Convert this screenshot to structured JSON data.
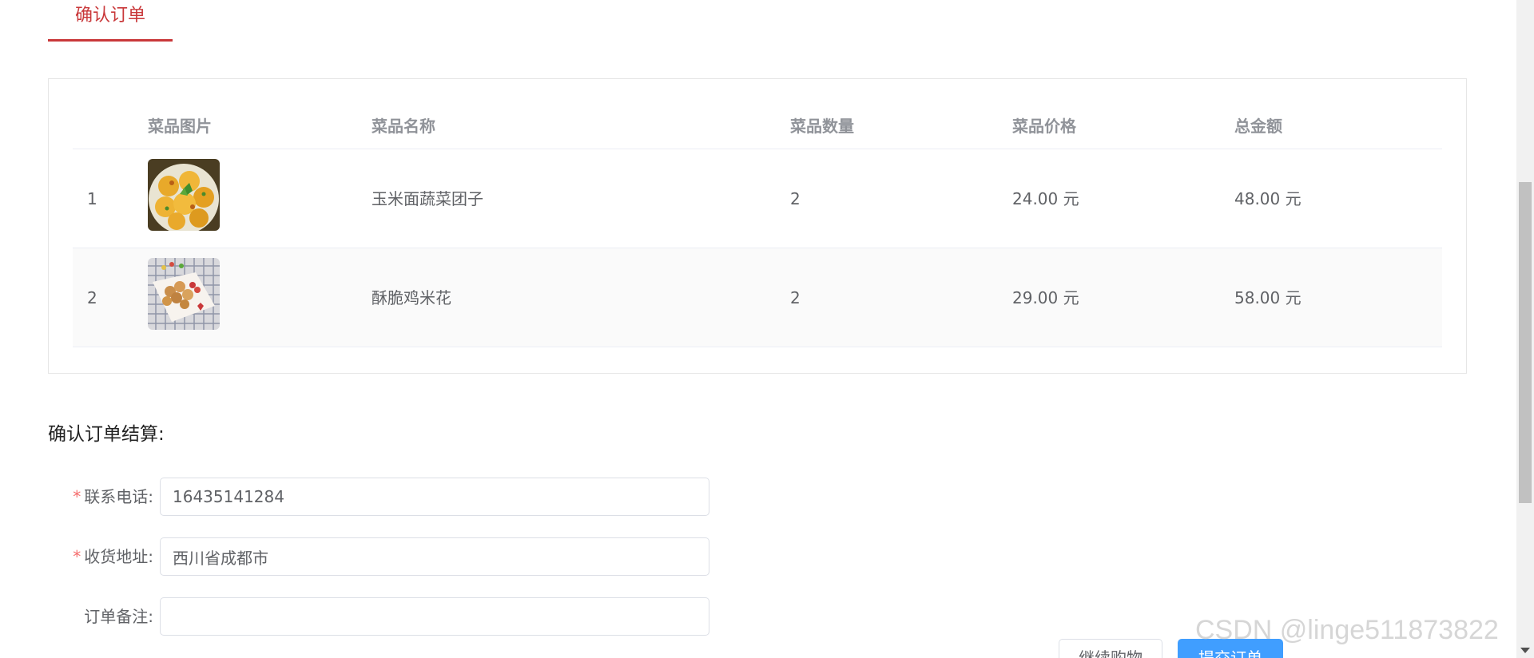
{
  "tab": {
    "label": "确认订单"
  },
  "table": {
    "headers": [
      "菜品图片",
      "菜品名称",
      "菜品数量",
      "菜品价格",
      "总金额"
    ],
    "rows": [
      {
        "index": "1",
        "name": "玉米面蔬菜团子",
        "quantity": "2",
        "price": "24.00 元",
        "total": "48.00 元"
      },
      {
        "index": "2",
        "name": "酥脆鸡米花",
        "quantity": "2",
        "price": "29.00 元",
        "total": "58.00 元"
      }
    ]
  },
  "settlement": {
    "title": "确认订单结算:",
    "phone": {
      "required_mark": "*",
      "label": "联系电话:",
      "value": "16435141284"
    },
    "address": {
      "required_mark": "*",
      "label": "收货地址:",
      "value": "西川省成都市"
    },
    "remark": {
      "label": "订单备注:",
      "value": ""
    }
  },
  "buttons": {
    "continue_label": "继续购物",
    "submit_label": "提交订单"
  },
  "watermark": "CSDN @linge511873822",
  "colors": {
    "accent_red": "#c9383a",
    "primary_blue": "#409eff",
    "required_red": "#f56c6c"
  }
}
